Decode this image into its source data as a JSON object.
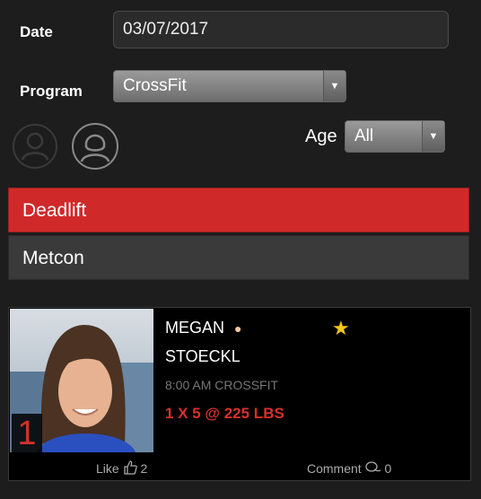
{
  "form": {
    "date_label": "Date",
    "date_value": "03/07/2017",
    "program_label": "Program",
    "program_value": "CrossFit",
    "age_label": "Age",
    "age_value": "All"
  },
  "tabs": [
    {
      "label": "Deadlift",
      "active": true
    },
    {
      "label": "Metcon",
      "active": false
    }
  ],
  "entry": {
    "rank": "1",
    "first_name": "MEGAN",
    "last_name": "STOECKL",
    "class": "8:00 AM CROSSFIT",
    "result": "1 X 5 @ 225 LBS",
    "like_label": "Like",
    "like_count": "2",
    "comment_label": "Comment",
    "comment_count": "0"
  },
  "colors": {
    "active_tab": "#d0292a",
    "inactive_tab": "#3a3a3a",
    "result": "#d9302b"
  }
}
